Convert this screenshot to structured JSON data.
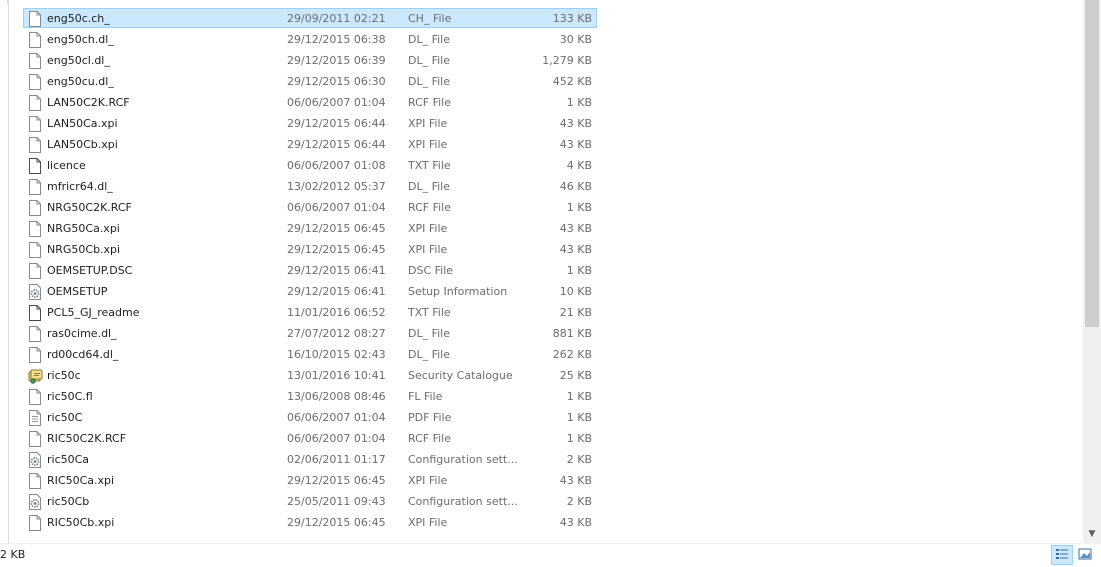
{
  "files": [
    {
      "name": "eng50c.ch_",
      "date": "29/09/2011 02:21",
      "type": "CH_ File",
      "size": "133 KB",
      "icon": "blank-file-icon",
      "selected": true
    },
    {
      "name": "eng50ch.dl_",
      "date": "29/12/2015 06:38",
      "type": "DL_ File",
      "size": "30 KB",
      "icon": "blank-file-icon"
    },
    {
      "name": "eng50cl.dl_",
      "date": "29/12/2015 06:39",
      "type": "DL_ File",
      "size": "1,279 KB",
      "icon": "blank-file-icon"
    },
    {
      "name": "eng50cu.dl_",
      "date": "29/12/2015 06:30",
      "type": "DL_ File",
      "size": "452 KB",
      "icon": "blank-file-icon"
    },
    {
      "name": "LAN50C2K.RCF",
      "date": "06/06/2007 01:04",
      "type": "RCF File",
      "size": "1 KB",
      "icon": "blank-file-icon"
    },
    {
      "name": "LAN50Ca.xpi",
      "date": "29/12/2015 06:44",
      "type": "XPI File",
      "size": "43 KB",
      "icon": "blank-file-icon"
    },
    {
      "name": "LAN50Cb.xpi",
      "date": "29/12/2015 06:44",
      "type": "XPI File",
      "size": "43 KB",
      "icon": "blank-file-icon"
    },
    {
      "name": "licence",
      "date": "06/06/2007 01:08",
      "type": "TXT File",
      "size": "4 KB",
      "icon": "text-file-icon"
    },
    {
      "name": "mfricr64.dl_",
      "date": "13/02/2012 05:37",
      "type": "DL_ File",
      "size": "46 KB",
      "icon": "blank-file-icon"
    },
    {
      "name": "NRG50C2K.RCF",
      "date": "06/06/2007 01:04",
      "type": "RCF File",
      "size": "1 KB",
      "icon": "blank-file-icon"
    },
    {
      "name": "NRG50Ca.xpi",
      "date": "29/12/2015 06:45",
      "type": "XPI File",
      "size": "43 KB",
      "icon": "blank-file-icon"
    },
    {
      "name": "NRG50Cb.xpi",
      "date": "29/12/2015 06:45",
      "type": "XPI File",
      "size": "43 KB",
      "icon": "blank-file-icon"
    },
    {
      "name": "OEMSETUP.DSC",
      "date": "29/12/2015 06:41",
      "type": "DSC File",
      "size": "1 KB",
      "icon": "blank-file-icon"
    },
    {
      "name": "OEMSETUP",
      "date": "29/12/2015 06:41",
      "type": "Setup Information",
      "size": "10 KB",
      "icon": "gear-file-icon"
    },
    {
      "name": "PCL5_GJ_readme",
      "date": "11/01/2016 06:52",
      "type": "TXT File",
      "size": "21 KB",
      "icon": "text-file-icon"
    },
    {
      "name": "ras0cime.dl_",
      "date": "27/07/2012 08:27",
      "type": "DL_ File",
      "size": "881 KB",
      "icon": "blank-file-icon"
    },
    {
      "name": "rd00cd64.dl_",
      "date": "16/10/2015 02:43",
      "type": "DL_ File",
      "size": "262 KB",
      "icon": "blank-file-icon"
    },
    {
      "name": "ric50c",
      "date": "13/01/2016 10:41",
      "type": "Security Catalogue",
      "size": "25 KB",
      "icon": "catalog-file-icon"
    },
    {
      "name": "ric50C.fl",
      "date": "13/06/2008 08:46",
      "type": "FL File",
      "size": "1 KB",
      "icon": "blank-file-icon"
    },
    {
      "name": "ric50C",
      "date": "06/06/2007 01:04",
      "type": "PDF File",
      "size": "1 KB",
      "icon": "pdf-file-icon"
    },
    {
      "name": "RIC50C2K.RCF",
      "date": "06/06/2007 01:04",
      "type": "RCF File",
      "size": "1 KB",
      "icon": "blank-file-icon"
    },
    {
      "name": "ric50Ca",
      "date": "02/06/2011 01:17",
      "type": "Configuration sett...",
      "size": "2 KB",
      "icon": "gear-file-icon"
    },
    {
      "name": "RIC50Ca.xpi",
      "date": "29/12/2015 06:45",
      "type": "XPI File",
      "size": "43 KB",
      "icon": "blank-file-icon"
    },
    {
      "name": "ric50Cb",
      "date": "25/05/2011 09:43",
      "type": "Configuration sett...",
      "size": "2 KB",
      "icon": "gear-file-icon"
    },
    {
      "name": "RIC50Cb.xpi",
      "date": "29/12/2015 06:45",
      "type": "XPI File",
      "size": "43 KB",
      "icon": "blank-file-icon"
    }
  ],
  "status": {
    "selection_size": "2 KB"
  },
  "scroll": {
    "position_fraction": 0.0,
    "visible_fraction": 0.6
  },
  "colors": {
    "selected_bg": "#cce8ff",
    "selected_border": "#99d1ff",
    "secondary_text": "#6d6d6d"
  }
}
